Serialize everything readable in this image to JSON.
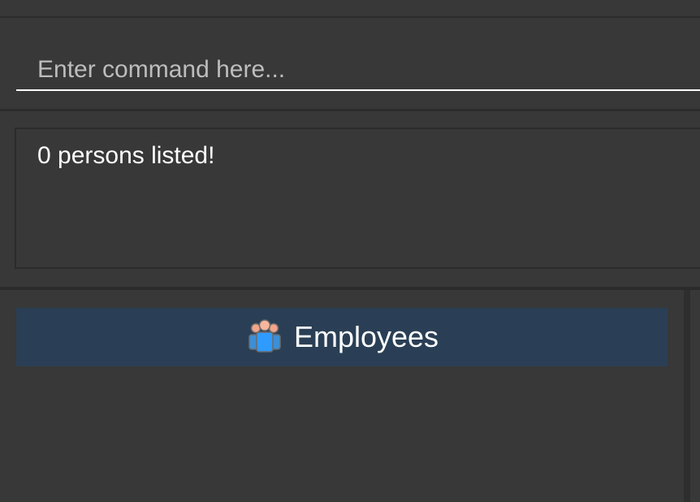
{
  "window": {
    "partial_title": ""
  },
  "command": {
    "placeholder": "Enter command here..."
  },
  "result": {
    "message": "0 persons listed!"
  },
  "list": {
    "header_label": "Employees",
    "header_icon": "people-icon"
  },
  "colors": {
    "background": "#383838",
    "header_bg": "#2a3f55",
    "text": "#ffffff",
    "placeholder": "#bdbdbd"
  }
}
